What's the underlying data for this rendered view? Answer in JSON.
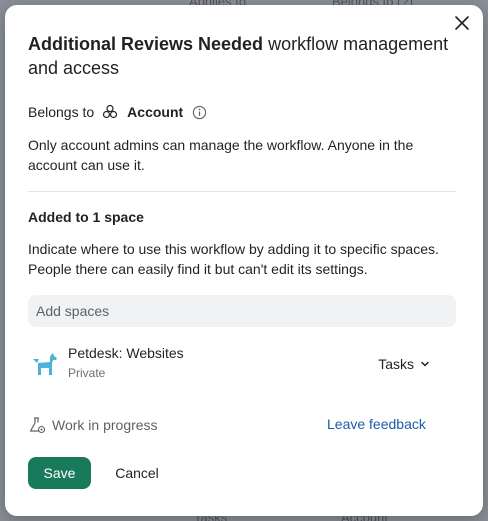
{
  "background": {
    "top_labels": [
      "Applies to",
      "Belongs to  (?)"
    ],
    "bottom_labels": [
      "Tasks",
      "Account"
    ]
  },
  "dialog": {
    "title_bold": "Additional Reviews Needed",
    "title_rest": " workflow management and access",
    "belongs_label": "Belongs to",
    "belongs_value": "Account",
    "belongs_desc": "Only account admins can manage the workflow. Anyone in the account can use it.",
    "spaces_title": "Added to 1 space",
    "spaces_desc": "Indicate where to use this workflow by adding it to specific spaces. People there can easily find it but can't edit its settings.",
    "add_spaces_placeholder": "Add spaces",
    "space": {
      "name": "Petdesk: Websites",
      "visibility": "Private",
      "role": "Tasks"
    },
    "wip_label": "Work in progress",
    "feedback_link": "Leave feedback",
    "save_label": "Save",
    "cancel_label": "Cancel"
  },
  "colors": {
    "primary": "#187a5b",
    "link": "#1b5dab",
    "space_icon": "#4bb3d6"
  }
}
